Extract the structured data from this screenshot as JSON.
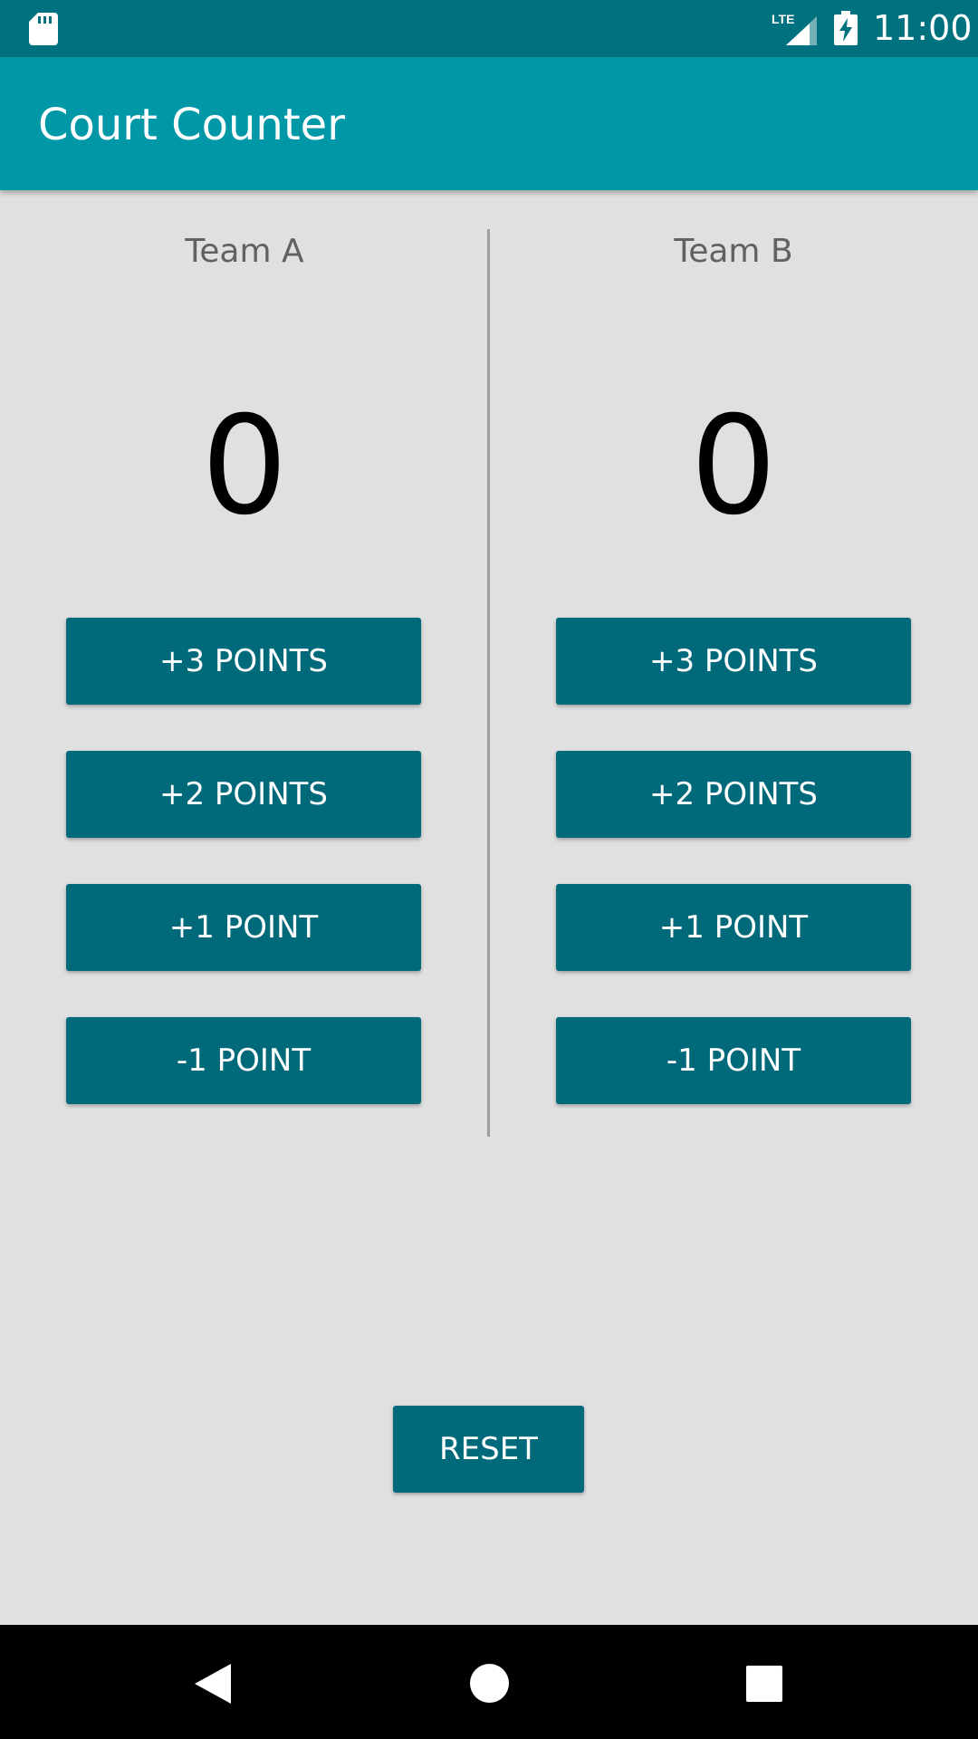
{
  "status_bar": {
    "time": "11:00",
    "network": "LTE",
    "icons": [
      "sd-card-icon",
      "lte-signal-icon",
      "battery-charging-icon"
    ]
  },
  "app_bar": {
    "title": "Court Counter"
  },
  "teams": [
    {
      "name": "Team A",
      "score": "0",
      "buttons": [
        "+3 POINTS",
        "+2 POINTS",
        "+1 POINT",
        "-1 POINT"
      ]
    },
    {
      "name": "Team B",
      "score": "0",
      "buttons": [
        "+3 POINTS",
        "+2 POINTS",
        "+1 POINT",
        "-1 POINT"
      ]
    }
  ],
  "reset_label": "RESET",
  "nav_bar": {
    "icons": [
      "back-icon",
      "home-icon",
      "recents-icon"
    ]
  },
  "colors": {
    "status_bar": "#00727f",
    "app_bar": "#0097a7",
    "button": "#00697a",
    "background": "#e0e0e0",
    "team_name": "#616161",
    "score": "#000000",
    "divider": "#9e9e9e"
  }
}
